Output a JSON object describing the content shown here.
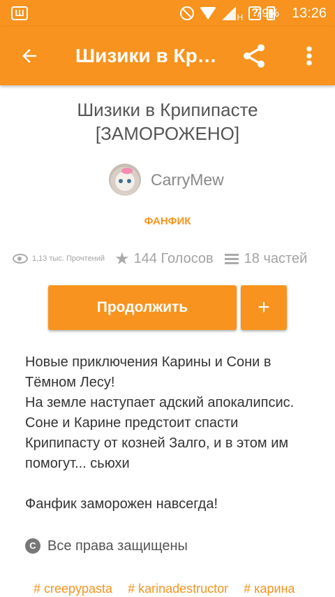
{
  "status_bar": {
    "app_badge": "Ш",
    "network_label": "H",
    "unknown_glyph": "?",
    "battery": "79%",
    "time": "13:26",
    "icons": [
      "app-badge-icon",
      "dnd-icon",
      "wifi-icon",
      "signal-icon",
      "battery-icon"
    ]
  },
  "app_bar": {
    "back_icon": "arrow-back-icon",
    "title": "Шизики в Крипипасте [ЗАМОРОЖЕНО]",
    "share_icon": "share-icon",
    "menu_icon": "more-vertical-icon",
    "accent_color": "#f7931e"
  },
  "story": {
    "title": "Шизики в Крипипасте [ЗАМОРОЖЕНО]",
    "author": "CarryMew",
    "category": "ФАНФИК",
    "reads": "1,13 тыс. Прочтений",
    "votes": "144 Голосов",
    "parts": "18 частей"
  },
  "actions": {
    "continue_label": "Продолжить",
    "add_label": "+"
  },
  "description": "Новые приключения Карины и Сони в Тёмном Лесу!\n На земле наступает адский апокалипсис. Соне и Карине предстоит спасти Крипипасту от козней Залго, и в этом им помогут... сьюхи\n\nФанфик заморожен навсегда!",
  "copyright": {
    "icon_letter": "C",
    "label": "Все права защищены"
  },
  "tags": [
    "# creepypasta",
    "# karinadestructor",
    "# карина"
  ]
}
